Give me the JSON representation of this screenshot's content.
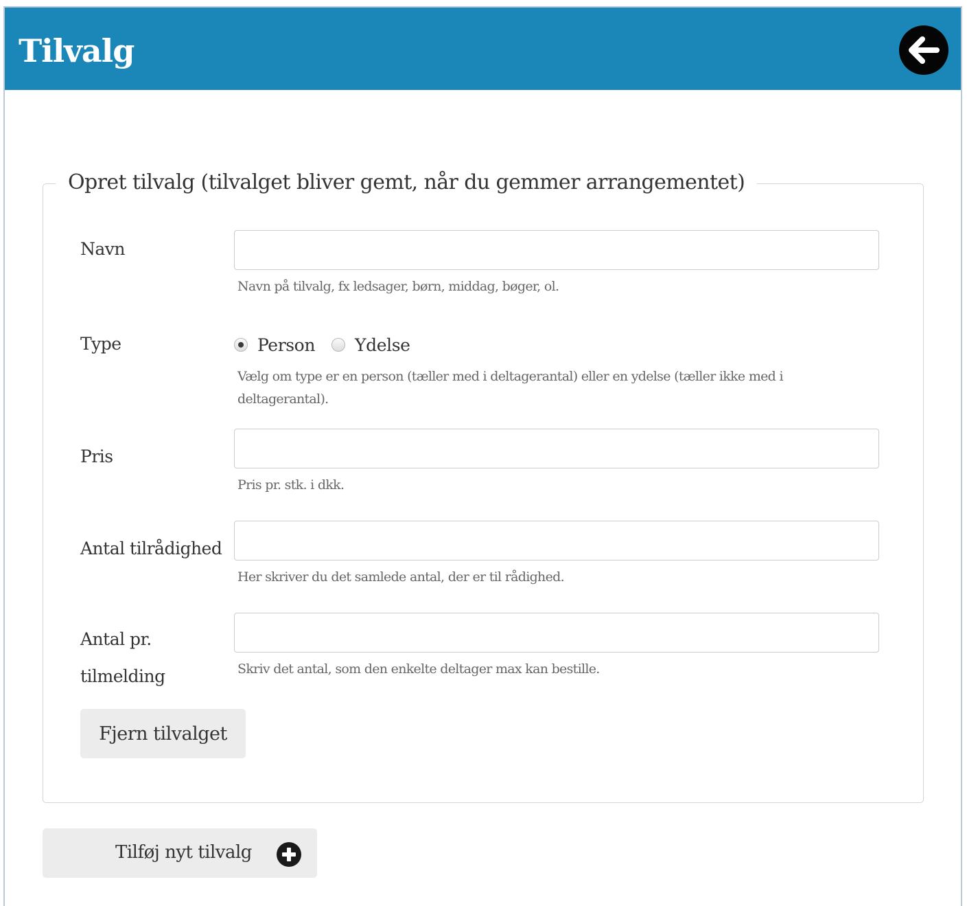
{
  "header": {
    "title": "Tilvalg",
    "back_icon": "arrow-left-circle-icon",
    "color": "#1b87b8"
  },
  "form": {
    "legend": "Opret tilvalg (tilvalget bliver gemt, når du gemmer arrangementet)",
    "navn": {
      "label": "Navn",
      "value": "",
      "help": "Navn på tilvalg, fx ledsager, børn, middag, bøger, ol."
    },
    "type": {
      "label": "Type",
      "options": [
        "Person",
        "Ydelse"
      ],
      "selected": "Person",
      "help": "Vælg om type er en person (tæller med i deltagerantal) eller en ydelse (tæller ikke med i deltagerantal)."
    },
    "pris": {
      "label": "Pris",
      "value": "",
      "help": "Pris pr. stk. i dkk."
    },
    "antal_tilraadighed": {
      "label": "Antal tilrådighed",
      "value": "",
      "help": "Her skriver du det samlede antal, der er til rådighed."
    },
    "antal_pr_tilmelding": {
      "label": "Antal pr. tilmelding",
      "value": "",
      "help": "Skriv det antal, som den enkelte deltager max kan bestille."
    },
    "remove_button": "Fjern tilvalget"
  },
  "add_button": {
    "label": "Tilføj nyt tilvalg",
    "icon": "plus-circle-icon"
  }
}
